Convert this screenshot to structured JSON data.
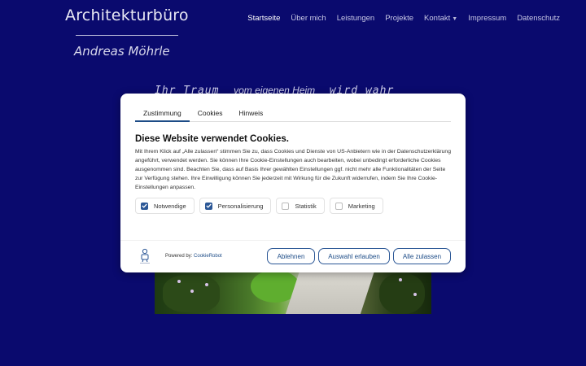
{
  "brand": {
    "title": "Architekturbüro",
    "name": "Andreas Möhrle"
  },
  "nav": {
    "items": [
      {
        "label": "Startseite",
        "active": true
      },
      {
        "label": "Über mich"
      },
      {
        "label": "Leistungen"
      },
      {
        "label": "Projekte"
      },
      {
        "label": "Kontakt",
        "dropdown": true
      },
      {
        "label": "Impressum"
      },
      {
        "label": "Datenschutz"
      }
    ],
    "dropdown_icon": "caret-down"
  },
  "hero": {
    "part1": "Ihr Traum",
    "part2": "vom eigenen Heim",
    "part3": "wird wahr"
  },
  "cookie_dialog": {
    "tabs": [
      "Zustimmung",
      "Cookies",
      "Hinweis"
    ],
    "active_tab": "Zustimmung",
    "heading": "Diese Website verwendet Cookies.",
    "text": "Mit Ihrem Klick auf „Alle zulassen“ stimmen Sie zu, dass Cookies und Dienste von US-Anbietern wie in der Datenschutzerklärung angeführt, verwendet werden. Sie können Ihre Cookie-Einstellungen auch bearbeiten, wobei unbedingt erforderliche Cookies ausgenommen sind. Beachten Sie, dass auf Basis Ihrer gewählten Einstellungen ggf. nicht mehr alle Funktionalitäten der Seite zur Verfügung stehen. Ihre Einwilligung können Sie jederzeit mit Wirkung für die Zukunft widerrufen, indem Sie Ihre Cookie-Einstellungen anpassen.",
    "checkboxes": [
      {
        "label": "Notwendige",
        "checked": true
      },
      {
        "label": "Personalisierung",
        "checked": true
      },
      {
        "label": "Statistik",
        "checked": false
      },
      {
        "label": "Marketing",
        "checked": false
      }
    ],
    "powered_by": "Powered by:",
    "powered_link": "CookieRobot",
    "buttons": {
      "reject": "Ablehnen",
      "select": "Auswahl erlauben",
      "accept": "Alle zulassen"
    },
    "colors": {
      "accent": "#2b5796",
      "page_background": "#0a0a6e"
    }
  }
}
